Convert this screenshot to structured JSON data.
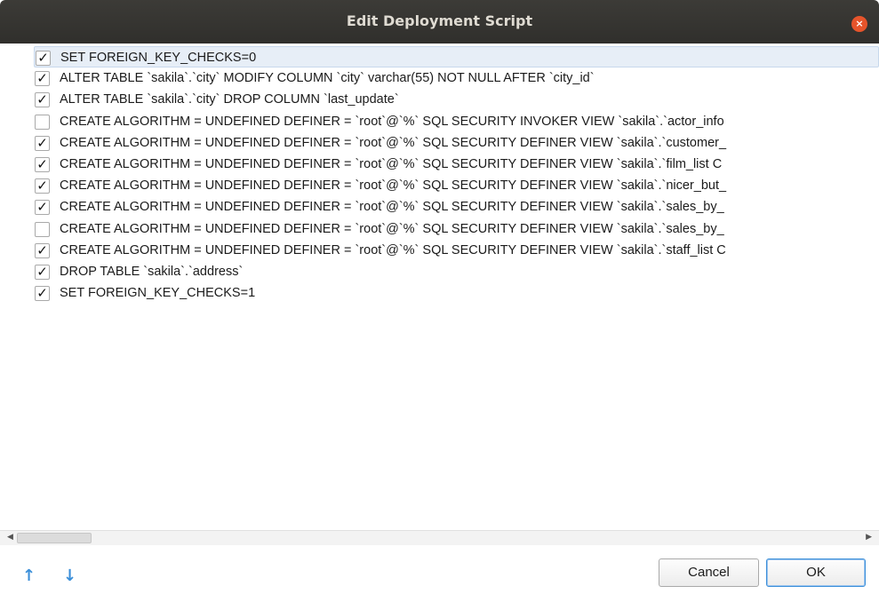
{
  "window": {
    "title": "Edit Deployment Script",
    "close_symbol": "×"
  },
  "items": [
    {
      "checked": true,
      "text": "SET FOREIGN_KEY_CHECKS=0",
      "selected": true
    },
    {
      "checked": true,
      "text": "ALTER TABLE `sakila`.`city` MODIFY COLUMN `city` varchar(55) NOT NULL AFTER `city_id`"
    },
    {
      "checked": true,
      "text": "ALTER TABLE `sakila`.`city` DROP COLUMN `last_update`"
    },
    {
      "checked": false,
      "text": "CREATE ALGORITHM = UNDEFINED DEFINER = `root`@`%` SQL SECURITY INVOKER VIEW `sakila`.`actor_info"
    },
    {
      "checked": true,
      "text": "CREATE ALGORITHM = UNDEFINED DEFINER = `root`@`%` SQL SECURITY DEFINER VIEW `sakila`.`customer_"
    },
    {
      "checked": true,
      "text": "CREATE ALGORITHM = UNDEFINED DEFINER = `root`@`%` SQL SECURITY DEFINER VIEW `sakila`.`film_list C"
    },
    {
      "checked": true,
      "text": "CREATE ALGORITHM = UNDEFINED DEFINER = `root`@`%` SQL SECURITY DEFINER VIEW `sakila`.`nicer_but_"
    },
    {
      "checked": true,
      "text": "CREATE ALGORITHM = UNDEFINED DEFINER = `root`@`%` SQL SECURITY DEFINER VIEW `sakila`.`sales_by_"
    },
    {
      "checked": false,
      "text": "CREATE ALGORITHM = UNDEFINED DEFINER = `root`@`%` SQL SECURITY DEFINER VIEW `sakila`.`sales_by_"
    },
    {
      "checked": true,
      "text": "CREATE ALGORITHM = UNDEFINED DEFINER = `root`@`%` SQL SECURITY DEFINER VIEW `sakila`.`staff_list C"
    },
    {
      "checked": true,
      "text": "DROP TABLE `sakila`.`address`"
    },
    {
      "checked": true,
      "text": "SET FOREIGN_KEY_CHECKS=1"
    }
  ],
  "checkmark": "✓",
  "scrollbar": {
    "left_arrow": "◀",
    "right_arrow": "▶"
  },
  "footer": {
    "move_up_icon": "🡑",
    "move_down_icon": "🡓",
    "up_glyph": "↑",
    "down_glyph": "↓",
    "cancel_label": "Cancel",
    "ok_label": "OK"
  },
  "colors": {
    "titlebar": "#3c3b37",
    "close_button": "#e6542b",
    "selection": "#e7eef7",
    "arrow_blue": "#3b8fd9"
  }
}
